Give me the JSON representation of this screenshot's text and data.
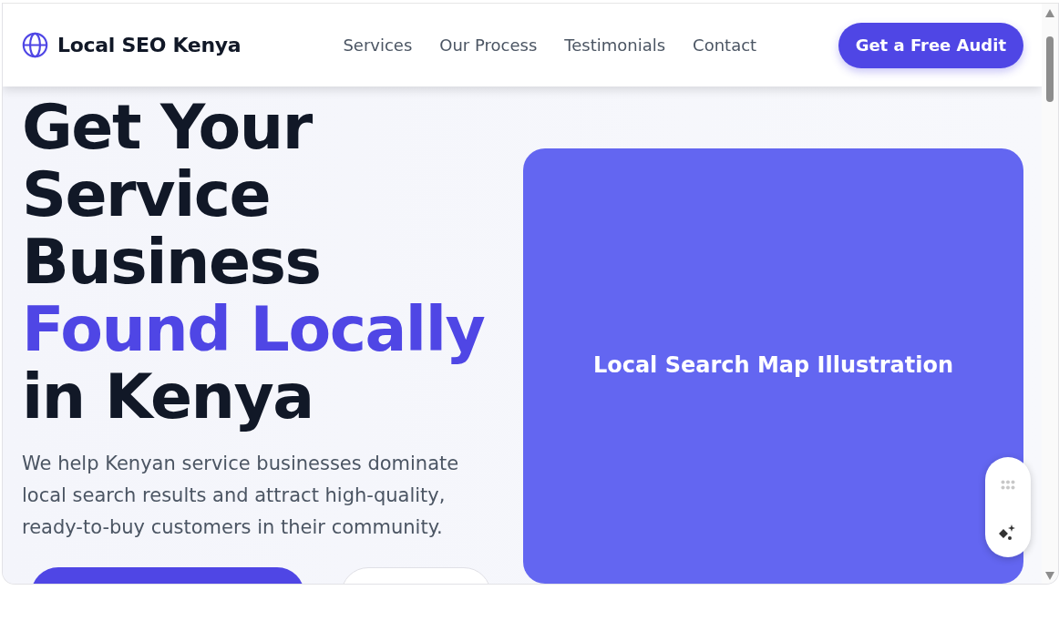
{
  "header": {
    "brand": "Local SEO Kenya",
    "nav": [
      {
        "label": "Services"
      },
      {
        "label": "Our Process"
      },
      {
        "label": "Testimonials"
      },
      {
        "label": "Contact"
      }
    ],
    "cta": "Get a Free Audit"
  },
  "hero": {
    "headline": [
      {
        "text": "Get Your",
        "accent": false
      },
      {
        "text": "Service",
        "accent": false
      },
      {
        "text": "Business",
        "accent": false
      },
      {
        "text": "Found Locally",
        "accent": true
      },
      {
        "text": "in Kenya",
        "accent": false
      }
    ],
    "description": "We help Kenyan service businesses dominate local search results and attract high-quality, ready-to-buy customers in their community.",
    "illustration_label": "Local Search Map Illustration"
  }
}
